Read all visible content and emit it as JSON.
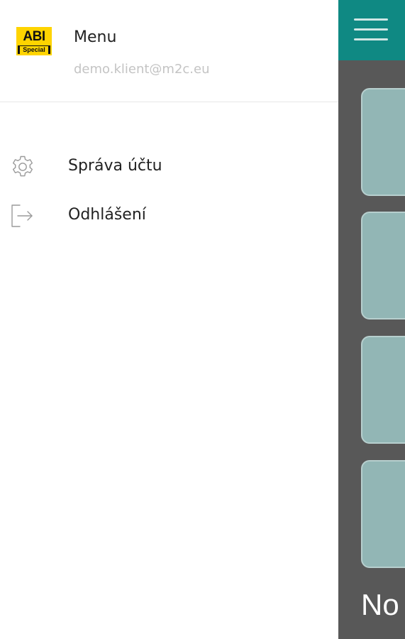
{
  "drawer": {
    "logo": {
      "top_text": "ABI",
      "bottom_text": "Special"
    },
    "title": "Menu",
    "email": "demo.klient@m2c.eu",
    "items": [
      {
        "label": "Správa účtu",
        "icon": "gear-icon"
      },
      {
        "label": "Odhlášení",
        "icon": "logout-icon"
      }
    ]
  },
  "background_app": {
    "caption": "No",
    "colors": {
      "topbar": "#0f8983",
      "content": "#585858",
      "tile": "#92b6b5"
    }
  }
}
